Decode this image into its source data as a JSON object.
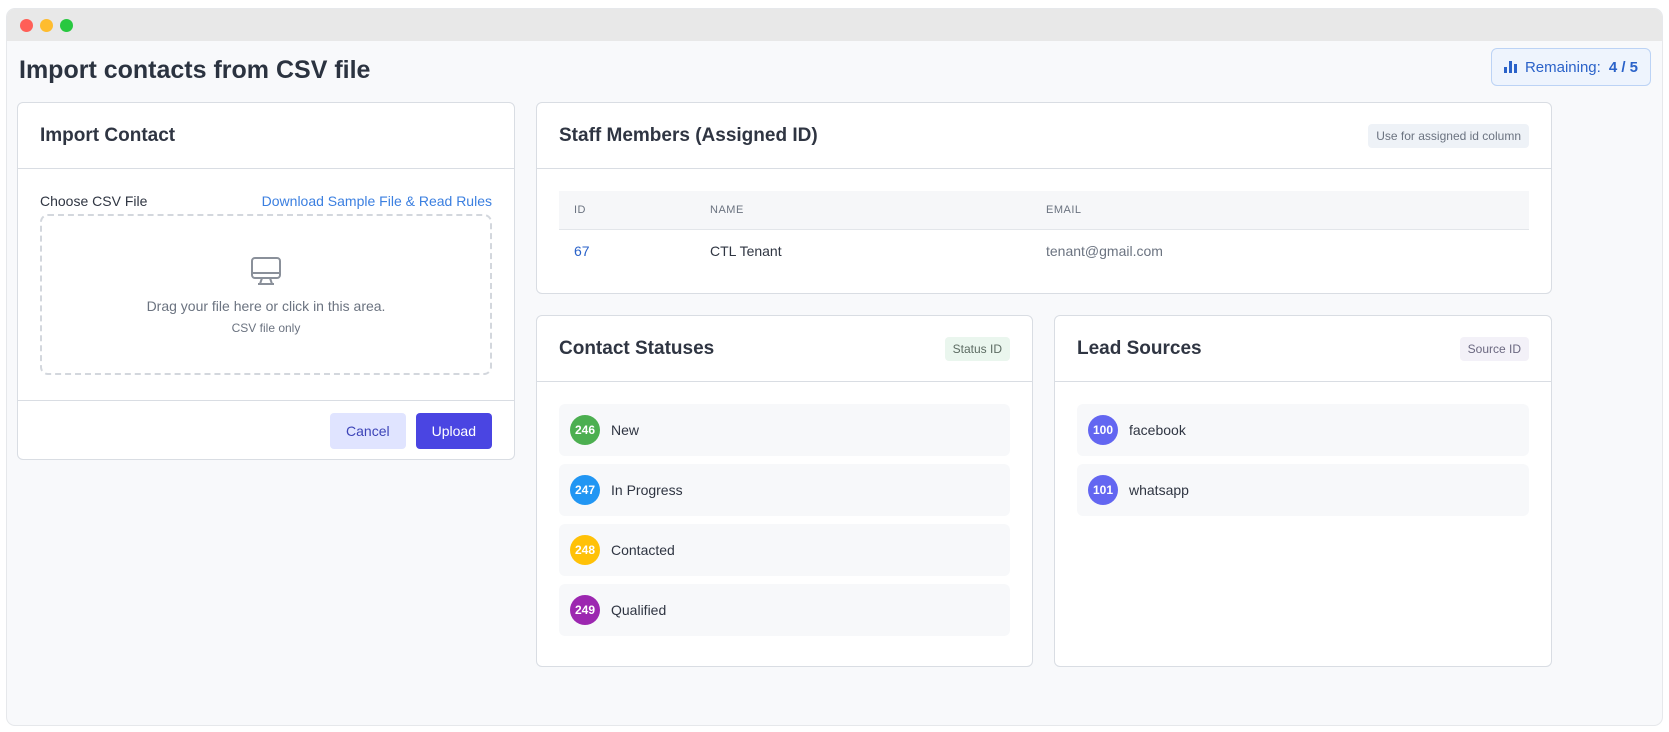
{
  "page": {
    "title": "Import contacts from CSV file"
  },
  "remaining": {
    "label": "Remaining:",
    "value": "4 / 5",
    "icon": "bar-chart-icon",
    "color": "#2a62c9"
  },
  "import": {
    "title": "Import Contact",
    "choose_label": "Choose CSV File",
    "download_link": "Download Sample File & Read Rules",
    "drop_main": "Drag your file here or click in this area.",
    "drop_sub": "CSV file only",
    "icon": "monitor-icon",
    "cancel_label": "Cancel",
    "upload_label": "Upload"
  },
  "staff": {
    "title": "Staff Members (Assigned ID)",
    "pill": "Use for assigned id column",
    "columns": [
      "ID",
      "NAME",
      "EMAIL"
    ],
    "rows": [
      {
        "id": "67",
        "name": "CTL Tenant",
        "email": "tenant@gmail.com"
      }
    ]
  },
  "statuses": {
    "title": "Contact Statuses",
    "pill": "Status ID",
    "items": [
      {
        "id": "246",
        "label": "New",
        "color": "#4caf50"
      },
      {
        "id": "247",
        "label": "In Progress",
        "color": "#2196f3"
      },
      {
        "id": "248",
        "label": "Contacted",
        "color": "#ffc107"
      },
      {
        "id": "249",
        "label": "Qualified",
        "color": "#9c27b0"
      }
    ]
  },
  "sources": {
    "title": "Lead Sources",
    "pill": "Source ID",
    "items": [
      {
        "id": "100",
        "label": "facebook",
        "color": "#6366f1"
      },
      {
        "id": "101",
        "label": "whatsapp",
        "color": "#6366f1"
      }
    ]
  }
}
